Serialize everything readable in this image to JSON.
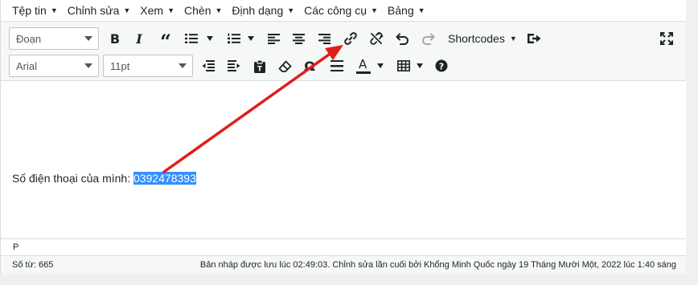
{
  "menubar": {
    "items": [
      "Tệp tin",
      "Chỉnh sửa",
      "Xem",
      "Chèn",
      "Định dạng",
      "Các công cụ",
      "Bảng"
    ]
  },
  "toolbar": {
    "format_select": "Đoạn",
    "font_family_select": "Arial",
    "font_size_select": "11pt",
    "shortcodes_label": "Shortcodes",
    "row1_icons": [
      "bold-icon",
      "italic-icon",
      "blockquote-icon",
      "bullet-list-icon",
      "numbered-list-icon",
      "align-left-icon",
      "align-center-icon",
      "align-right-icon",
      "insert-link-icon",
      "remove-link-icon",
      "undo-icon",
      "redo-icon",
      "distraction-free-icon",
      "fullscreen-icon"
    ],
    "row2_icons": [
      "outdent-icon",
      "indent-icon",
      "paste-text-icon",
      "clear-formatting-icon",
      "special-character-icon",
      "horizontal-line-icon",
      "text-color-icon",
      "table-icon",
      "help-icon"
    ],
    "bold_label": "B",
    "italic_label": "I",
    "quote_label": "“",
    "text_color_label": "A"
  },
  "content": {
    "prefix": "Số điện thoại của mình: ",
    "selected": "0392478393"
  },
  "pathbar": {
    "path": "P"
  },
  "status": {
    "word_count": "Số từ: 665",
    "autosave": "Bản nháp được lưu lúc 02:49:03. Chỉnh sửa lần cuối bởi Khổng Minh Quốc ngày 19 Tháng Mười Một, 2022 lúc 1:40 sáng"
  },
  "colors": {
    "selection": "#3390ff",
    "annotation_arrow": "#e11d1d",
    "text_color_bar": "#1d2327"
  }
}
